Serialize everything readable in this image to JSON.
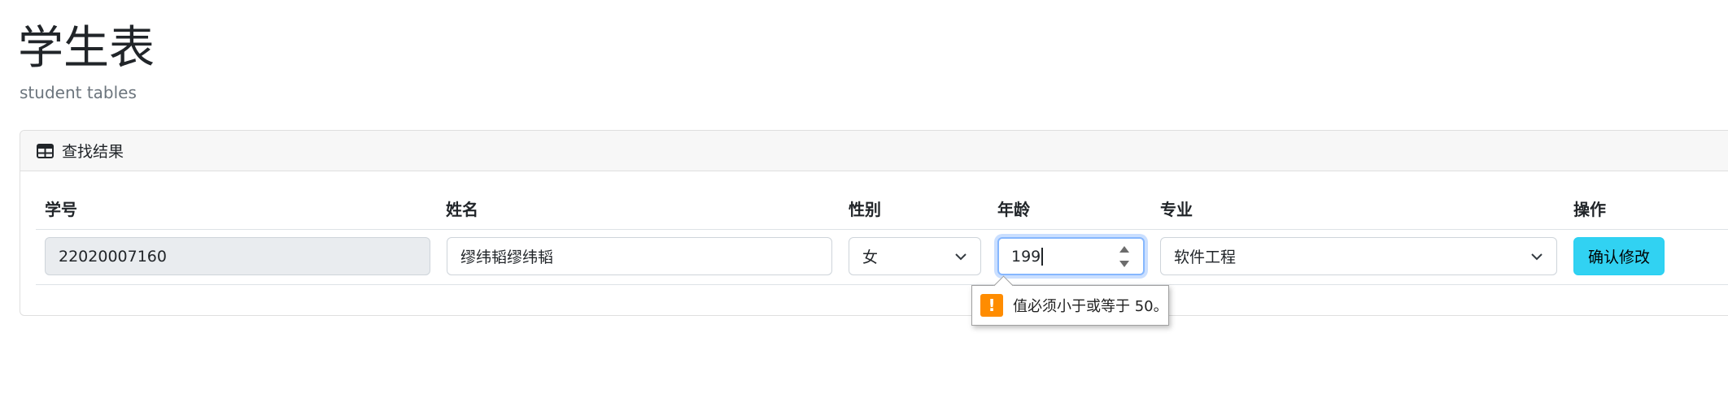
{
  "header": {
    "title": "学生表",
    "subtitle": "student tables"
  },
  "card": {
    "title": "查找结果",
    "icon": "table-icon"
  },
  "table": {
    "columns": [
      "学号",
      "姓名",
      "性别",
      "年龄",
      "专业",
      "操作"
    ],
    "row": {
      "student_id": "22020007160",
      "name": "缪纬韬缪纬韬",
      "gender": "女",
      "age": "199",
      "major": "软件工程",
      "action_label": "确认修改"
    }
  },
  "validation": {
    "message": "值必须小于或等于 50。",
    "icon": "warning-icon",
    "icon_glyph": "!"
  },
  "colors": {
    "accent_button": "#31d2f2",
    "warning": "#ff8c00",
    "focus_ring": "#86b7fe"
  }
}
